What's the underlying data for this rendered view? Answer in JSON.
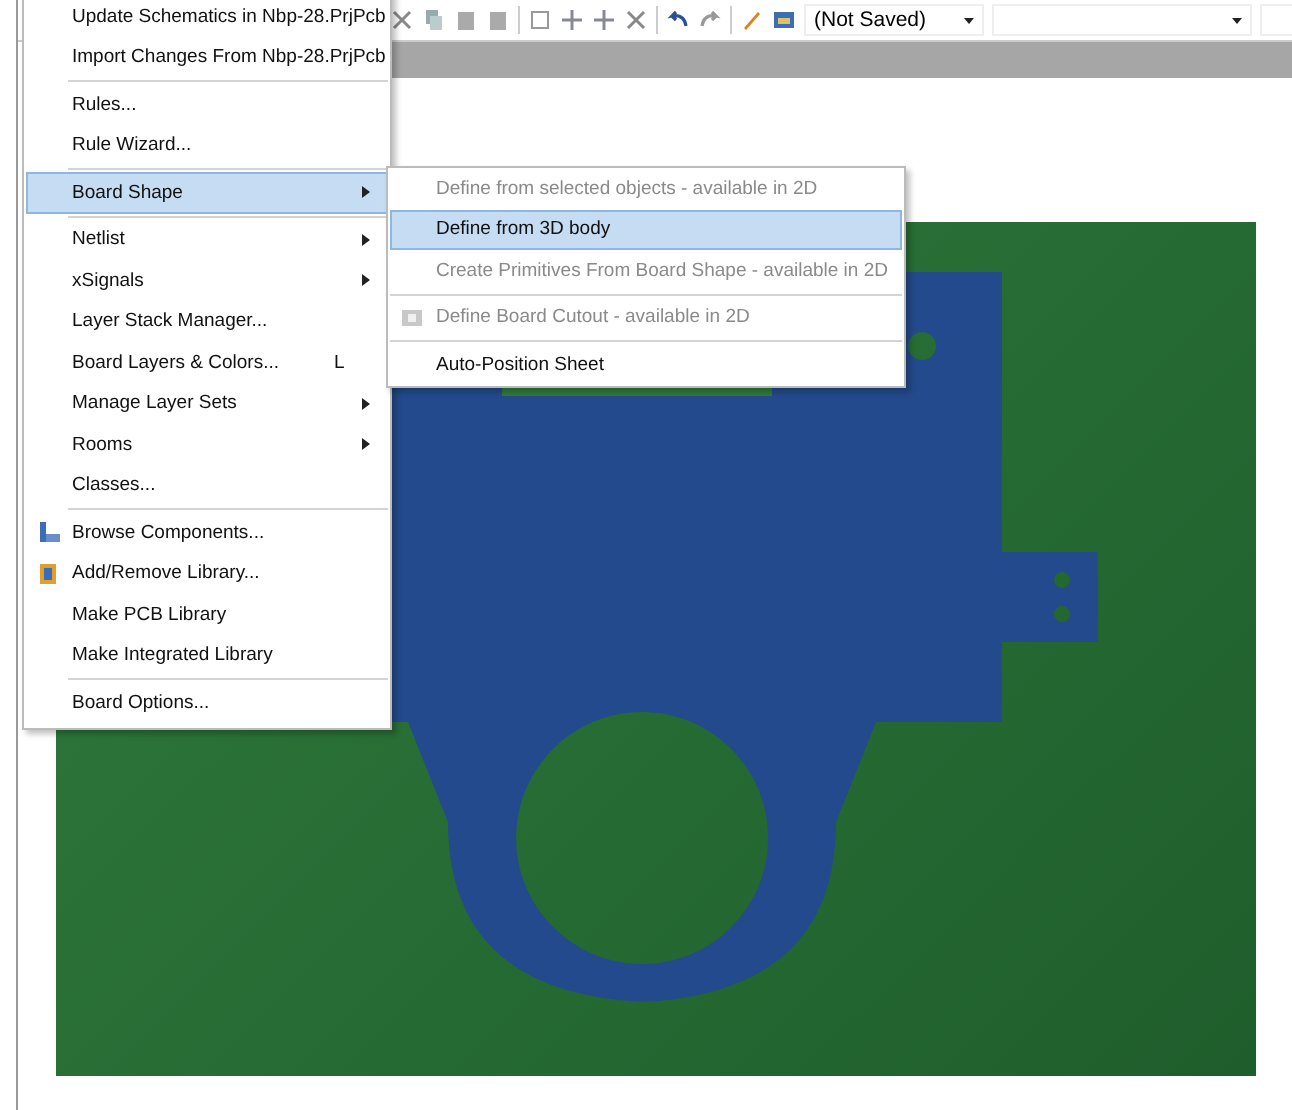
{
  "toolbar": {
    "dropdowns": [
      {
        "value": "(Not Saved)"
      },
      {
        "kind": "blank"
      },
      {
        "kind": "blank"
      }
    ]
  },
  "menu": {
    "groups": [
      {
        "items": [
          {
            "label": "Update Schematics in Nbp-28.PrjPcb",
            "submenu": false,
            "selected": false
          },
          {
            "label": "Import Changes From Nbp-28.PrjPcb",
            "submenu": false,
            "selected": false
          }
        ]
      },
      {
        "items": [
          {
            "label": "Rules...",
            "submenu": false,
            "selected": false
          },
          {
            "label": "Rule Wizard...",
            "submenu": false,
            "selected": false
          }
        ]
      },
      {
        "items": [
          {
            "label": "Board Shape",
            "submenu": true,
            "selected": true
          }
        ]
      },
      {
        "items": [
          {
            "label": "Netlist",
            "submenu": true,
            "selected": false
          },
          {
            "label": "xSignals",
            "submenu": true,
            "selected": false
          },
          {
            "label": "Layer Stack Manager...",
            "submenu": false,
            "selected": false
          },
          {
            "label": "Board Layers & Colors...",
            "shortcut": "L",
            "submenu": false,
            "selected": false
          },
          {
            "label": "Manage Layer Sets",
            "submenu": true,
            "selected": false
          },
          {
            "label": "Rooms",
            "submenu": true,
            "selected": false
          },
          {
            "label": "Classes...",
            "submenu": false,
            "selected": false
          }
        ]
      },
      {
        "items": [
          {
            "label": "Browse Components...",
            "kind": "browse",
            "submenu": false,
            "selected": false
          },
          {
            "label": "Add/Remove Library...",
            "kind": "library",
            "submenu": false,
            "selected": false
          },
          {
            "label": "Make PCB Library",
            "submenu": false,
            "selected": false
          },
          {
            "label": "Make Integrated Library",
            "submenu": false,
            "selected": false
          }
        ]
      },
      {
        "items": [
          {
            "label": "Board Options...",
            "submenu": false,
            "selected": false
          }
        ]
      }
    ]
  },
  "submenu": {
    "groups": [
      {
        "items": [
          {
            "label": "Define from selected objects - available in 2D",
            "disabled": true,
            "selected": false
          },
          {
            "label": "Define from 3D body",
            "disabled": false,
            "selected": true
          },
          {
            "label": "Create Primitives From Board Shape - available in 2D",
            "disabled": true,
            "selected": false
          }
        ]
      },
      {
        "items": [
          {
            "label": "Define Board Cutout - available in 2D",
            "kind": "cutout",
            "disabled": true,
            "selected": false
          }
        ]
      },
      {
        "items": [
          {
            "label": "Auto-Position Sheet",
            "disabled": false,
            "selected": false
          }
        ]
      }
    ]
  }
}
